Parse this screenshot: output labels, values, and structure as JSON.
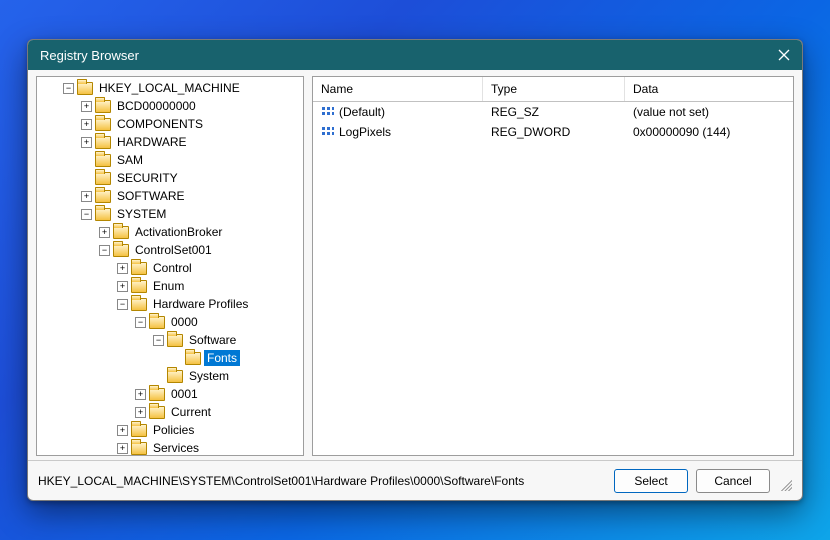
{
  "window": {
    "title": "Registry Browser"
  },
  "columns": {
    "name": "Name",
    "type": "Type",
    "data": "Data"
  },
  "values": [
    {
      "name": "(Default)",
      "type": "REG_SZ",
      "data": "(value not set)"
    },
    {
      "name": "LogPixels",
      "type": "REG_DWORD",
      "data": "0x00000090 (144)"
    }
  ],
  "path": "HKEY_LOCAL_MACHINE\\SYSTEM\\ControlSet001\\Hardware Profiles\\0000\\Software\\Fonts",
  "buttons": {
    "select": "Select",
    "cancel": "Cancel"
  },
  "tree": {
    "root": "HKEY_LOCAL_MACHINE",
    "children": {
      "bcd": "BCD00000000",
      "components": "COMPONENTS",
      "hardware": "HARDWARE",
      "sam": "SAM",
      "security": "SECURITY",
      "software": "SOFTWARE",
      "system": "SYSTEM",
      "system_children": {
        "activationbroker": "ActivationBroker",
        "controlset001": "ControlSet001",
        "cs_children": {
          "control": "Control",
          "enum": "Enum",
          "hardwareprofiles": "Hardware Profiles",
          "hp_children": {
            "p0000": "0000",
            "p0000_children": {
              "software": "Software",
              "software_children": {
                "fonts": "Fonts"
              },
              "system": "System"
            },
            "p0001": "0001",
            "current": "Current"
          },
          "policies": "Policies",
          "services": "Services"
        }
      }
    }
  }
}
